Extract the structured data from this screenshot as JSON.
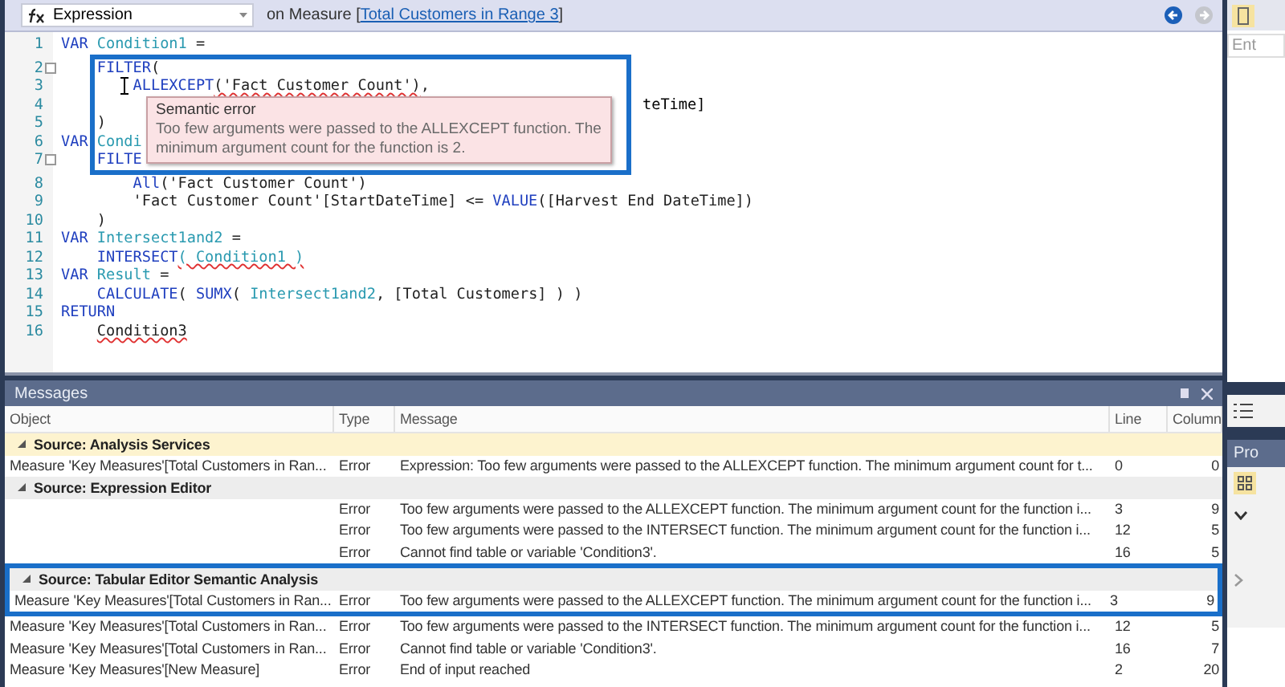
{
  "toolbar": {
    "property": "Expression",
    "context": "on Measure [",
    "measure_link": "Total Customers in Range 3",
    "context_end": "]",
    "back_enabled": true,
    "forward_enabled": false
  },
  "editor": {
    "lines": [
      {
        "number": "1",
        "tokens": [
          {
            "text": "VAR ",
            "kind": "kw"
          },
          {
            "text": "Condition1",
            "kind": "var"
          },
          {
            "text": " =",
            "kind": "plain"
          }
        ]
      },
      {
        "number": "2",
        "fold": true,
        "tokens": [
          {
            "text": "    FILTER",
            "kind": "kw"
          },
          {
            "text": "(",
            "kind": "plain"
          }
        ]
      },
      {
        "number": "3",
        "tokens": [
          {
            "text": "        ALLEXCEPT",
            "kind": "kw"
          },
          {
            "text": "('Fact Customer Count')",
            "kind": "plain",
            "error": true
          },
          {
            "text": ",",
            "kind": "plain"
          }
        ]
      },
      {
        "number": "4",
        "after_tooltip": "teTime]"
      },
      {
        "number": "5",
        "tokens": [
          {
            "text": "    )",
            "kind": "plain"
          }
        ]
      },
      {
        "number": "6",
        "tokens": [
          {
            "text": "VAR ",
            "kind": "kw"
          },
          {
            "text": "Condi",
            "kind": "var"
          }
        ]
      },
      {
        "number": "7",
        "fold": true,
        "tokens": [
          {
            "text": "    FILTE",
            "kind": "kw"
          }
        ]
      },
      {
        "number": "8",
        "tokens": [
          {
            "text": "        All",
            "kind": "kw"
          },
          {
            "text": "('Fact Customer Count')",
            "kind": "plain"
          }
        ]
      },
      {
        "number": "9",
        "tokens": [
          {
            "text": "        'Fact Customer Count'[StartDateTime] <= ",
            "kind": "plain"
          },
          {
            "text": "VALUE",
            "kind": "kw"
          },
          {
            "text": "([Harvest End DateTime])",
            "kind": "plain"
          }
        ]
      },
      {
        "number": "10",
        "tokens": [
          {
            "text": "    )",
            "kind": "plain"
          }
        ]
      },
      {
        "number": "11",
        "tokens": [
          {
            "text": "VAR ",
            "kind": "kw"
          },
          {
            "text": "Intersect1and2",
            "kind": "var"
          },
          {
            "text": " =",
            "kind": "plain"
          }
        ]
      },
      {
        "number": "12",
        "tokens": [
          {
            "text": "    INTERSECT",
            "kind": "kw"
          },
          {
            "text": "( Condition1 )",
            "kind": "var",
            "error": true
          }
        ]
      },
      {
        "number": "13",
        "tokens": [
          {
            "text": "VAR ",
            "kind": "kw"
          },
          {
            "text": "Result",
            "kind": "var"
          },
          {
            "text": " =",
            "kind": "plain"
          }
        ]
      },
      {
        "number": "14",
        "tokens": [
          {
            "text": "    CALCULATE",
            "kind": "kw"
          },
          {
            "text": "( ",
            "kind": "plain"
          },
          {
            "text": "SUMX",
            "kind": "kw"
          },
          {
            "text": "( ",
            "kind": "plain"
          },
          {
            "text": "Intersect1and2",
            "kind": "var"
          },
          {
            "text": ", [Total Customers] ) )",
            "kind": "plain"
          }
        ]
      },
      {
        "number": "15",
        "tokens": [
          {
            "text": "RETURN",
            "kind": "kw"
          }
        ]
      },
      {
        "number": "16",
        "tokens": [
          {
            "text": "    Condition3",
            "kind": "plain",
            "error": true
          }
        ]
      }
    ],
    "tooltip": {
      "title": "Semantic error",
      "body": "Too few arguments were passed to the ALLEXCEPT function. The minimum argument count for the function is 2."
    }
  },
  "side_panel": {
    "search_placeholder": "Ent",
    "properties_title": "Pro"
  },
  "messages": {
    "title": "Messages",
    "columns": [
      "Object",
      "Type",
      "Message",
      "Line",
      "Column"
    ],
    "groups": [
      {
        "title": "Source: Analysis Services",
        "selected": true,
        "expanded": true,
        "rows": [
          {
            "object": "Measure 'Key Measures'[Total Customers in Ran...",
            "type": "Error",
            "message": "Expression: Too few arguments were passed to the ALLEXCEPT function. The minimum argument count for t...",
            "line": "0",
            "column": "0"
          }
        ]
      },
      {
        "title": "Source: Expression Editor",
        "selected": false,
        "expanded": true,
        "rows": [
          {
            "type": "Error",
            "message": "Too few arguments were passed to the ALLEXCEPT function. The minimum argument count for the function i...",
            "line": "3",
            "column": "9"
          },
          {
            "type": "Error",
            "message": "Too few arguments were passed to the INTERSECT function. The minimum argument count for the function i...",
            "line": "12",
            "column": "5"
          },
          {
            "type": "Error",
            "message": "Cannot find table or variable 'Condition3'.",
            "line": "16",
            "column": "5"
          }
        ]
      },
      {
        "title": "Source: Tabular Editor Semantic Analysis",
        "selected": false,
        "expanded": true,
        "highlighted": true,
        "rows": [
          {
            "object": "Measure 'Key Measures'[Total Customers in Ran...",
            "type": "Error",
            "message": "Too few arguments were passed to the ALLEXCEPT function. The minimum argument count for the function i...",
            "line": "3",
            "column": "9"
          },
          {
            "object": "Measure 'Key Measures'[Total Customers in Ran...",
            "type": "Error",
            "message": "Too few arguments were passed to the INTERSECT function. The minimum argument count for the function i...",
            "line": "12",
            "column": "5"
          },
          {
            "object": "Measure 'Key Measures'[Total Customers in Ran...",
            "type": "Error",
            "message": "Cannot find table or variable 'Condition3'.",
            "line": "16",
            "column": "7"
          },
          {
            "object": "Measure 'Key Measures'[New Measure]",
            "type": "Error",
            "message": "End of input reached",
            "line": "2",
            "column": "20"
          }
        ]
      }
    ]
  }
}
